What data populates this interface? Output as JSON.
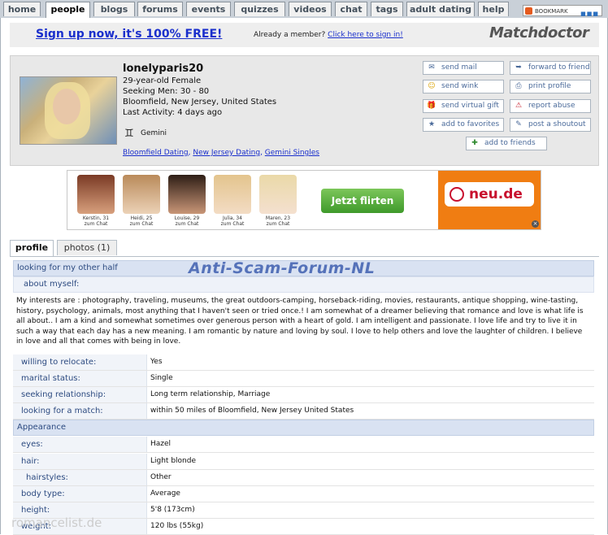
{
  "nav": {
    "tabs": [
      "home",
      "people",
      "blogs",
      "forums",
      "events",
      "quizzes",
      "videos",
      "chat",
      "tags",
      "adult dating",
      "help"
    ],
    "active": "people",
    "bookmark": "BOOKMARK"
  },
  "signup": {
    "link": "Sign up now, it's 100% FREE!",
    "member_text": "Already a member?",
    "member_link": "Click here to sign in!",
    "logo": "Matchdoctor"
  },
  "profile": {
    "username": "lonelyparis20",
    "line1": "29-year-old Female",
    "line2": "Seeking Men: 30 - 80",
    "line3": "Bloomfield, New Jersey, United States",
    "line4": "Last Activity: 4 days ago",
    "zodiac": "Gemini",
    "links": [
      "Bloomfield Dating",
      "New Jersey Dating",
      "Gemini Singles"
    ]
  },
  "actions": {
    "send_mail": "send mail",
    "forward": "forward to friend",
    "send_wink": "send wink",
    "print": "print profile",
    "gift": "send virtual gift",
    "report": "report abuse",
    "favorites": "add to favorites",
    "shoutout": "post a shoutout",
    "friends": "add to friends"
  },
  "ad": {
    "ladies": [
      {
        "name": "Kerstin, 31",
        "sub": "zum Chat"
      },
      {
        "name": "Heidi, 25",
        "sub": "zum Chat"
      },
      {
        "name": "Louise, 29",
        "sub": "zum Chat"
      },
      {
        "name": "Julia, 34",
        "sub": "zum Chat"
      },
      {
        "name": "Maren, 23",
        "sub": "zum Chat"
      }
    ],
    "button": "Jetzt flirten",
    "brand": "neu.de"
  },
  "tabs": {
    "profile": "profile",
    "photos": "photos (1)"
  },
  "watermark": "Anti-Scam-Forum-NL",
  "site_watermark": "romancelist.de",
  "sections": {
    "looking": "looking for my other half",
    "about": "about myself:",
    "about_text": "My interests are : photography, traveling, museums, the great outdoors-camping, horseback-riding, movies, restaurants, antique shopping, wine-tasting, history, psychology, animals, most anything that I haven't seen or tried once.! I am somewhat of a dreamer believing that romance and love is what life is all about.. I am a kind and somewhat sometimes over generous person with a heart of gold. I am intelligent and passionate. I love life and try to live it in such a way that each day has a new meaning. I am romantic by nature and loving by soul. I love to help others and love the laughter of children. I believe in love and all that comes with being in love.",
    "appearance": "Appearance"
  },
  "fields": {
    "relocate_label": "willing to relocate:",
    "relocate": "Yes",
    "marital_label": "marital status:",
    "marital": "Single",
    "seeking_label": "seeking relationship:",
    "seeking": "Long term relationship, Marriage",
    "match_label": "looking for a match:",
    "match": "within 50 miles of Bloomfield, New Jersey United States",
    "eyes_label": "eyes:",
    "eyes": "Hazel",
    "hair_label": "hair:",
    "hair": "Light blonde",
    "hairstyles_label": "hairstyles:",
    "hairstyles": "Other",
    "body_label": "body type:",
    "body": "Average",
    "height_label": "height:",
    "height": "5'8 (173cm)",
    "weight_label": "weight:",
    "weight": "120 lbs (55kg)"
  }
}
